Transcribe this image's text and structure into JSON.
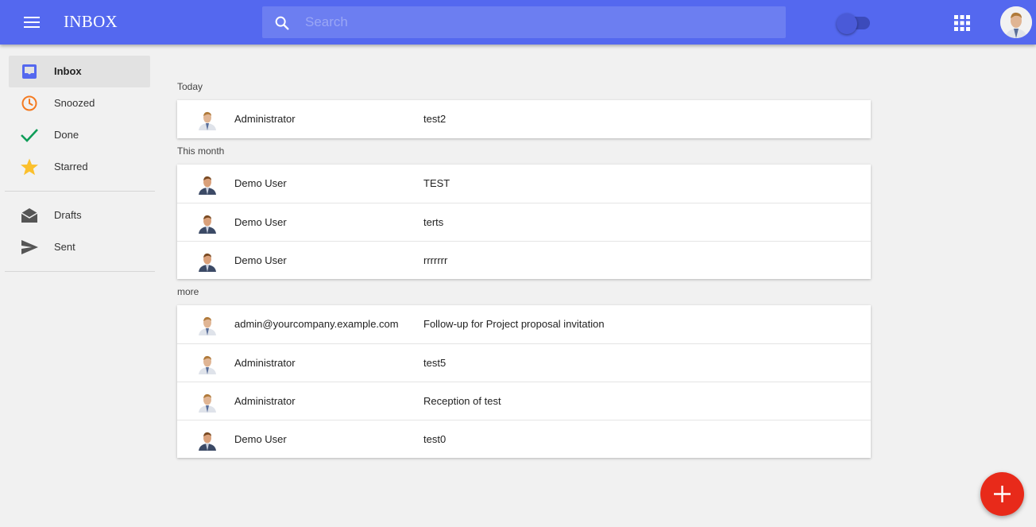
{
  "header": {
    "title": "INBOX",
    "search_placeholder": "Search",
    "search_value": "",
    "toggle_on": false,
    "accent_color": "#5468ef"
  },
  "sidebar": {
    "items": [
      {
        "label": "Inbox",
        "icon": "inbox-icon",
        "color": "#5468ef",
        "active": true
      },
      {
        "label": "Snoozed",
        "icon": "clock-icon",
        "color": "#f47a20",
        "active": false
      },
      {
        "label": "Done",
        "icon": "check-icon",
        "color": "#0f9d58",
        "active": false
      },
      {
        "label": "Starred",
        "icon": "star-icon",
        "color": "#fbc02d",
        "active": false
      },
      {
        "label": "Drafts",
        "icon": "drafts-icon",
        "color": "#555555",
        "active": false
      },
      {
        "label": "Sent",
        "icon": "send-icon",
        "color": "#555555",
        "active": false
      }
    ]
  },
  "sections": [
    {
      "label": "Today",
      "rows": [
        {
          "sender": "Administrator",
          "subject": "test2"
        }
      ]
    },
    {
      "label": "This month",
      "rows": [
        {
          "sender": "Demo User",
          "subject": "TEST"
        },
        {
          "sender": "Demo User",
          "subject": "terts"
        },
        {
          "sender": "Demo User",
          "subject": "rrrrrrr"
        }
      ]
    },
    {
      "label": "more",
      "rows": [
        {
          "sender": "admin@yourcompany.example.com",
          "subject": "Follow-up for Project proposal invitation"
        },
        {
          "sender": "Administrator",
          "subject": "test5"
        },
        {
          "sender": "Administrator",
          "subject": "Reception of test"
        },
        {
          "sender": "Demo User",
          "subject": "test0"
        }
      ]
    }
  ],
  "fab": {
    "icon": "plus-icon",
    "color": "#e82a1a"
  }
}
